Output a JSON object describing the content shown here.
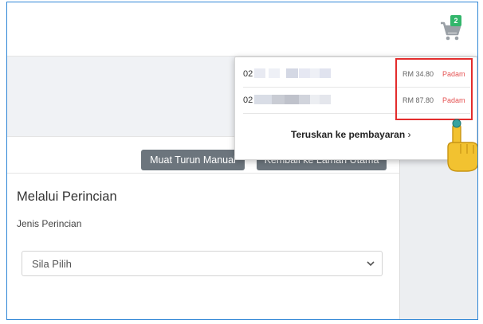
{
  "header": {
    "cart_count": "2"
  },
  "toolbar": {
    "download_label": "Muat Turun Manual",
    "home_label": "Kembali ke Laman Utama"
  },
  "section": {
    "title": "Melalui Perincian",
    "field_label": "Jenis Perincian",
    "select_value": "Sila Pilih"
  },
  "cart_dropdown": {
    "items": [
      {
        "id_prefix": "02",
        "price": "RM 34.80",
        "remove_label": "Padam"
      },
      {
        "id_prefix": "02",
        "price": "RM 87.80",
        "remove_label": "Padam"
      }
    ],
    "checkout_label": "Teruskan ke pembayaran",
    "checkout_chevron": "›"
  },
  "colors": {
    "accent": "#2f86d6",
    "badge": "#32b66b",
    "danger": "#e55353",
    "highlight": "#e32d2d",
    "button": "#6c757d",
    "pointer": "#f2c230"
  }
}
